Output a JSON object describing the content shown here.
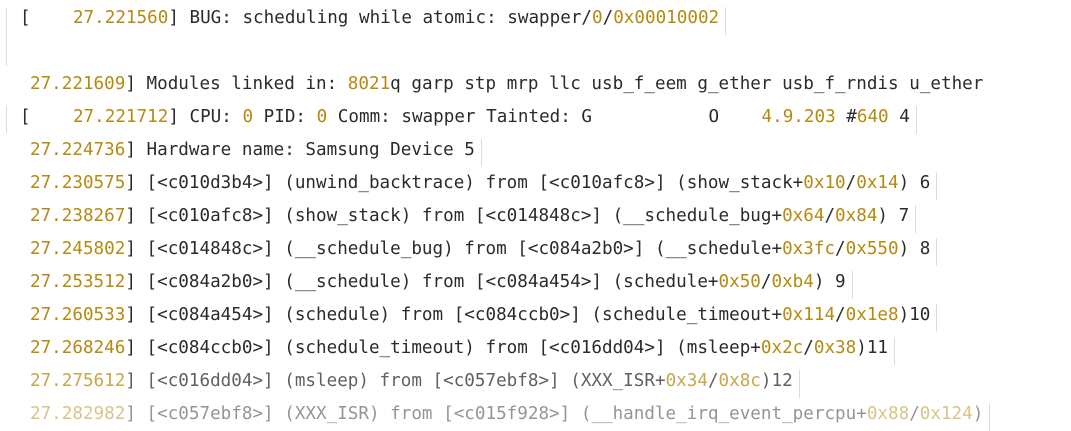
{
  "log": {
    "num_color": "#b58a10",
    "text_color": "#2b2b2b",
    "lines": [
      {
        "segments": [
          [
            "t",
            "[    "
          ],
          [
            "n",
            "27.221560"
          ],
          [
            "t",
            "] BUG: scheduling while atomic: swapper/"
          ],
          [
            "n",
            "0"
          ],
          [
            "t",
            "/"
          ],
          [
            "n",
            "0x00010002"
          ]
        ]
      },
      {
        "segments": [
          [
            "n",
            "27.221609"
          ],
          [
            "t",
            "] Modules linked in: "
          ],
          [
            "n",
            "8021"
          ],
          [
            "t",
            "q garp stp mrp llc usb_f_eem g_ether usb_f_rndis u_ether"
          ]
        ]
      },
      {
        "segments": [
          [
            "t",
            "[    "
          ],
          [
            "n",
            "27.221712"
          ],
          [
            "t",
            "] CPU: "
          ],
          [
            "n",
            "0"
          ],
          [
            "t",
            " PID: "
          ],
          [
            "n",
            "0"
          ],
          [
            "t",
            " Comm: swapper Tainted: G           O    "
          ],
          [
            "n",
            "4.9.203"
          ],
          [
            "t",
            " #"
          ],
          [
            "n",
            "640"
          ],
          [
            "t",
            " 4"
          ]
        ]
      },
      {
        "segments": [
          [
            "n",
            "27.224736"
          ],
          [
            "t",
            "] Hardware name: Samsung Device 5"
          ]
        ]
      },
      {
        "segments": [
          [
            "n",
            "27.230575"
          ],
          [
            "t",
            "] [<c010d3b4>] (unwind_backtrace) from [<c010afc8>] (show_stack+"
          ],
          [
            "n",
            "0x10"
          ],
          [
            "t",
            "/"
          ],
          [
            "n",
            "0x14"
          ],
          [
            "t",
            ") 6"
          ]
        ]
      },
      {
        "segments": [
          [
            "n",
            "27.238267"
          ],
          [
            "t",
            "] [<c010afc8>] (show_stack) from [<c014848c>] (__schedule_bug+"
          ],
          [
            "n",
            "0x64"
          ],
          [
            "t",
            "/"
          ],
          [
            "n",
            "0x84"
          ],
          [
            "t",
            ") 7"
          ]
        ]
      },
      {
        "segments": [
          [
            "n",
            "27.245802"
          ],
          [
            "t",
            "] [<c014848c>] (__schedule_bug) from [<c084a2b0>] (__schedule+"
          ],
          [
            "n",
            "0x3fc"
          ],
          [
            "t",
            "/"
          ],
          [
            "n",
            "0x550"
          ],
          [
            "t",
            ") 8"
          ]
        ]
      },
      {
        "segments": [
          [
            "n",
            "27.253512"
          ],
          [
            "t",
            "] [<c084a2b0>] (__schedule) from [<c084a454>] (schedule+"
          ],
          [
            "n",
            "0x50"
          ],
          [
            "t",
            "/"
          ],
          [
            "n",
            "0xb4"
          ],
          [
            "t",
            ") 9"
          ]
        ]
      },
      {
        "segments": [
          [
            "n",
            "27.260533"
          ],
          [
            "t",
            "] [<c084a454>] (schedule) from [<c084ccb0>] (schedule_timeout+"
          ],
          [
            "n",
            "0x114"
          ],
          [
            "t",
            "/"
          ],
          [
            "n",
            "0x1e8"
          ],
          [
            "t",
            ")10"
          ]
        ]
      },
      {
        "segments": [
          [
            "n",
            "27.268246"
          ],
          [
            "t",
            "] [<c084ccb0>] (schedule_timeout) from [<c016dd04>] (msleep+"
          ],
          [
            "n",
            "0x2c"
          ],
          [
            "t",
            "/"
          ],
          [
            "n",
            "0x38"
          ],
          [
            "t",
            ")11"
          ]
        ]
      },
      {
        "segments": [
          [
            "n",
            "27.275612"
          ],
          [
            "t",
            "] [<c016dd04>] (msleep) from [<c057ebf8>] (XXX_ISR+"
          ],
          [
            "n",
            "0x34"
          ],
          [
            "t",
            "/"
          ],
          [
            "n",
            "0x8c"
          ],
          [
            "t",
            ")12"
          ]
        ]
      },
      {
        "segments": [
          [
            "n",
            "27.282982"
          ],
          [
            "t",
            "] [<c057ebf8>] (XXX_ISR) from [<c015f928>] (__handle_irq_event_percpu+"
          ],
          [
            "n",
            "0x88"
          ],
          [
            "t",
            "/"
          ],
          [
            "n",
            "0x124"
          ],
          [
            "t",
            ")"
          ]
        ]
      }
    ]
  }
}
